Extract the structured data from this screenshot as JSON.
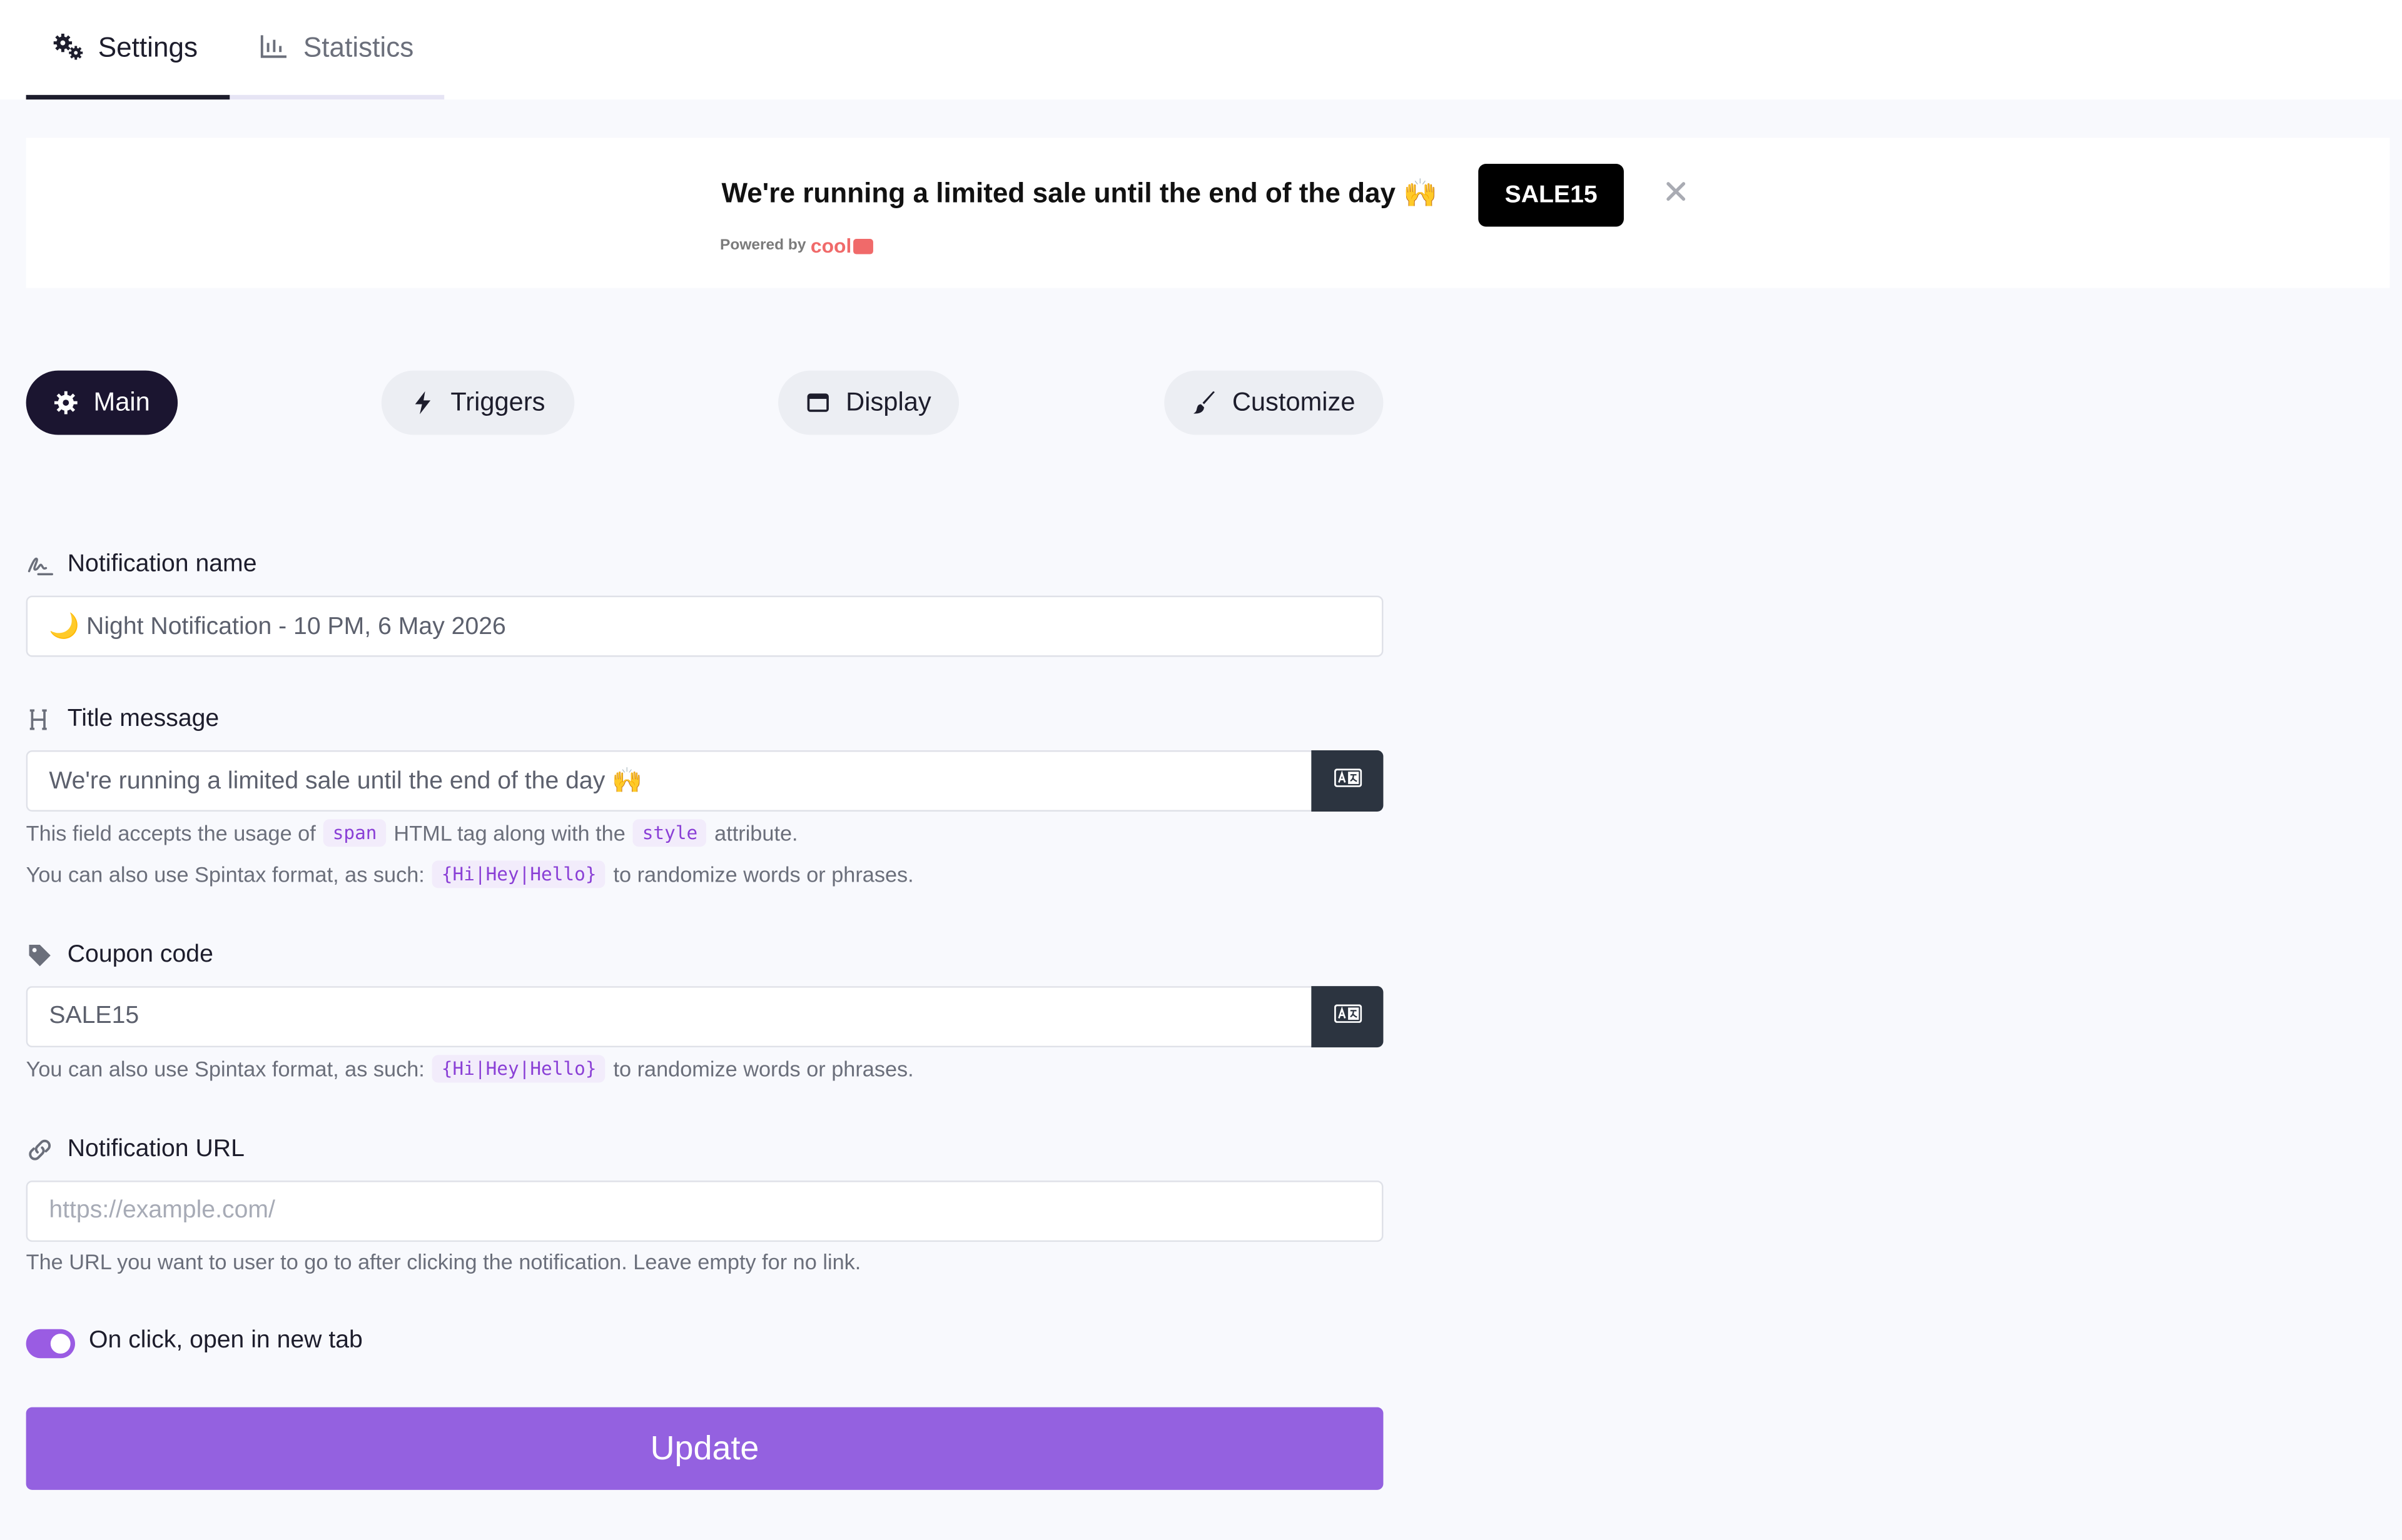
{
  "tabs": {
    "settings": "Settings",
    "statistics": "Statistics"
  },
  "preview": {
    "message": "We're running a limited sale until the end of the day 🙌",
    "powered_by": "Powered by",
    "brand": "cool",
    "coupon": "SALE15",
    "close_icon": "close-icon"
  },
  "sections": {
    "main": "Main",
    "triggers": "Triggers",
    "display": "Display",
    "customize": "Customize"
  },
  "form": {
    "name_label": "Notification name",
    "name_value": "🌙 Night Notification - 10 PM, 6 May 2026",
    "title_label": "Title message",
    "title_value": "We're running a limited sale until the end of the day 🙌",
    "title_help_1a": "This field accepts the usage of",
    "title_help_1_code1": "span",
    "title_help_1b": "HTML tag along with the",
    "title_help_1_code2": "style",
    "title_help_1c": "attribute.",
    "spintax_a": "You can also use Spintax format, as such:",
    "spintax_code": "{Hi|Hey|Hello}",
    "spintax_b": "to randomize words or phrases.",
    "coupon_label": "Coupon code",
    "coupon_value": "SALE15",
    "url_label": "Notification URL",
    "url_placeholder": "https://example.com/",
    "url_help": "The URL you want to user to go to after clicking the notification. Leave empty for no link.",
    "new_tab_label": "On click, open in new tab",
    "new_tab_enabled": true,
    "update_label": "Update"
  },
  "colors": {
    "accent": "#9461e0",
    "dark": "#1b1530"
  }
}
